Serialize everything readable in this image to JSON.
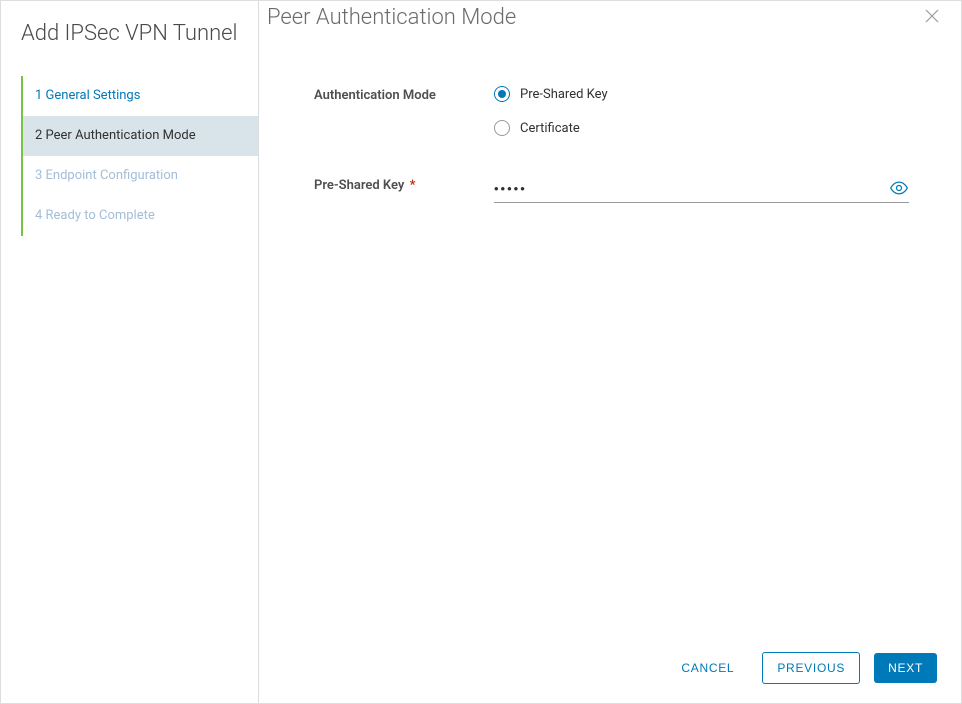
{
  "sidebar": {
    "title": "Add IPSec VPN Tunnel",
    "steps": [
      {
        "label": "1 General Settings"
      },
      {
        "label": "2 Peer Authentication Mode"
      },
      {
        "label": "3 Endpoint Configuration"
      },
      {
        "label": "4 Ready to Complete"
      }
    ]
  },
  "header": {
    "title": "Peer Authentication Mode"
  },
  "form": {
    "auth_mode_label": "Authentication Mode",
    "radio_psk": "Pre-Shared Key",
    "radio_cert": "Certificate",
    "psk_label": "Pre-Shared Key",
    "psk_required": "*",
    "psk_value": "•••••"
  },
  "footer": {
    "cancel": "Cancel",
    "previous": "Previous",
    "next": "Next"
  }
}
